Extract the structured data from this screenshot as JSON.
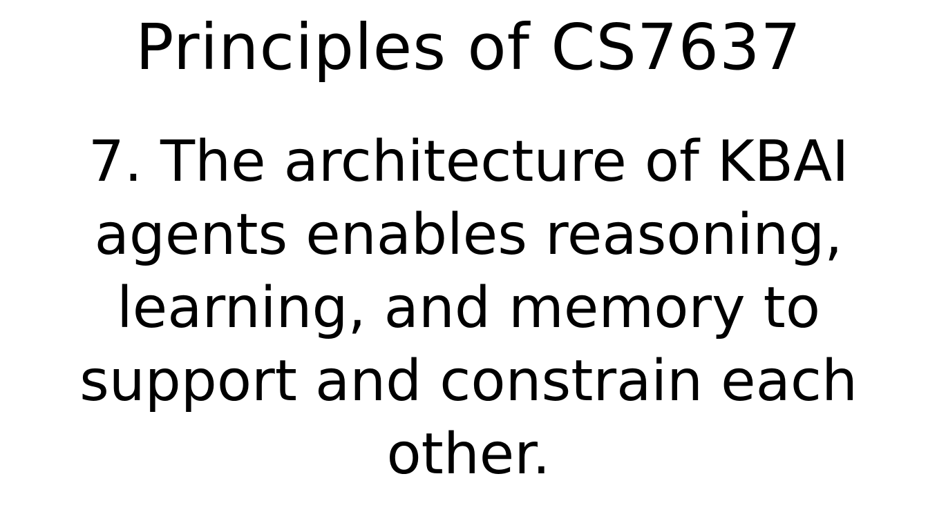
{
  "slide": {
    "title": "Principles of CS7637",
    "body_lines": [
      "7. The architecture of KBAI",
      "agents enables reasoning,",
      "learning, and memory to",
      "support and constrain each",
      "other."
    ]
  }
}
